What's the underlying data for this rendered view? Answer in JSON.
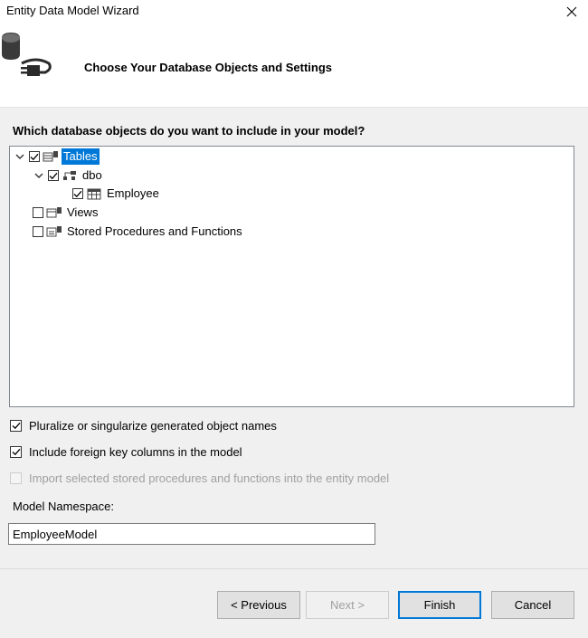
{
  "window": {
    "title": "Entity Data Model Wizard"
  },
  "header": {
    "title": "Choose Your Database Objects and Settings"
  },
  "question": "Which database objects do you want to include in your model?",
  "tree": {
    "tables": {
      "label": "Tables",
      "checked": true,
      "selected": true,
      "expanded": true
    },
    "dbo": {
      "label": "dbo",
      "checked": true,
      "expanded": true
    },
    "employee": {
      "label": "Employee",
      "checked": true
    },
    "views": {
      "label": "Views",
      "checked": false
    },
    "stored_procedures": {
      "label": "Stored Procedures and Functions",
      "checked": false
    }
  },
  "options": {
    "pluralize": {
      "label": "Pluralize or singularize generated object names",
      "checked": true
    },
    "foreign_keys": {
      "label": "Include foreign key columns in the model",
      "checked": true
    },
    "import_procs": {
      "label": "Import selected stored procedures and functions into the entity model",
      "checked": false,
      "enabled": false
    }
  },
  "namespace": {
    "label": "Model Namespace:",
    "value": "EmployeeModel"
  },
  "buttons": {
    "previous": "< Previous",
    "next": "Next >",
    "finish": "Finish",
    "cancel": "Cancel"
  },
  "colors": {
    "selection": "#0078d7",
    "panel": "#f0f0f0"
  }
}
